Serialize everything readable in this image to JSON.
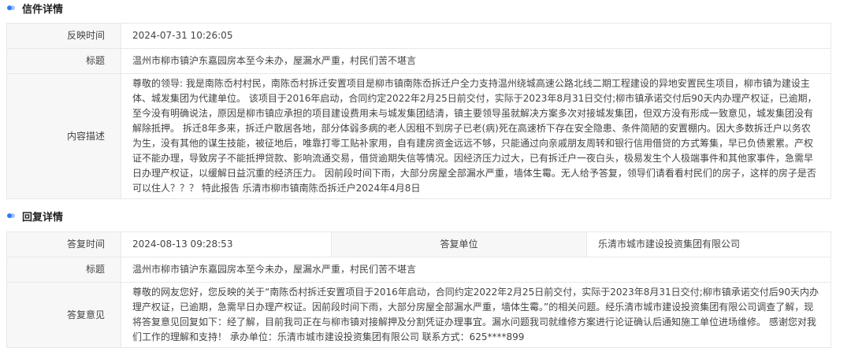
{
  "letter_section": {
    "title": "信件详情",
    "rows": {
      "feedback_time": {
        "label": "反映时间",
        "value": "2024-07-31 10:26:05"
      },
      "subject": {
        "label": "标题",
        "value": "温州市柳市镇沪东嘉园房本至今未办，屋漏水严重，村民们苦不堪言"
      },
      "content": {
        "label": "内容描述",
        "value": "尊敬的领导: 我是南陈岙村村民，南陈岙村拆迁安置项目是柳市镇南陈岙拆迁户全力支持温州绕城高速公路北线二期工程建设的异地安置民生项目，柳市镇为建设主体、城发集团为代建单位。 该项目于2016年启动，合同约定2022年2月25日前交付，实际于2023年8月31日交付;柳市镇承诺交付后90天内办理产权证，已逾期，至今没有明确说法，原因是柳市镇应承担的项目建设费用未与城发集团结清，镇主要领导虽就解决方案多次对接城发集团，但双方没有形成一致意见，城发集团没有解除抵押。 拆迁8年多来，拆迁户散居各地，部分体弱多病的老人因租不到房子已老(病)死在高速桥下存在安全隐患、条件简陋的安置棚内。因大多数拆迁户以务农为生，没有其他的谋生技能，被征地后，唯靠打零工贴补家用，自有建房资金远远不够，只能通过向亲戚朋友周转和银行信用借贷的方式筹集，早已负债累累。产权证不能办理，导致房子不能抵押贷款、影响流通交易，借贷逾期失信等情况。因经济压力过大，已有拆迁户一夜白头，极易发生个人极端事件和其他家事件，急需早日办理产权证，以缓解日益沉重的经济压力。 因前段时间下雨，大部分房屋全部漏水严重，墙体生霉。无人给予答复，领导们请看看村民们的房子，这样的房子是否可以住人？？？ 特此报告 乐清市柳市镇南陈岙拆迁户2024年4月8日"
      }
    }
  },
  "reply_section": {
    "title": "回复详情",
    "rows": {
      "reply_time": {
        "label": "答复时间",
        "value": "2024-08-13 09:28:53"
      },
      "reply_unit": {
        "label": "答复单位",
        "value": "乐清市城市建设投资集团有限公司"
      },
      "subject": {
        "label": "标题",
        "value": "温州市柳市镇沪东嘉园房本至今未办，屋漏水严重，村民们苦不堪言"
      },
      "opinion": {
        "label": "答复意见",
        "value": "尊敬的网友您好，您反映的关于“南陈岙村拆迁安置项目于2016年启动，合同约定2022年2月25日前交付，实际于2023年8月31日交付;柳市镇承诺交付后90天内办理产权证，已逾期，急需早日办理产权证。因前段时间下雨，大部分房屋全部漏水严重，墙体生霉。”的相关问题。经乐清市城市建设投资集团有限公司调查了解，现将答复意见回复如下：经了解，目前我司正在与柳市镇对接解押及分割凭证办理事宜。漏水问题我司就维修方案进行论证确认后通知施工单位进场维修。 感谢您对我们工作的理解和支持！ 承办单位：乐清市城市建设投资集团有限公司 联系方式：625****899"
      }
    }
  }
}
